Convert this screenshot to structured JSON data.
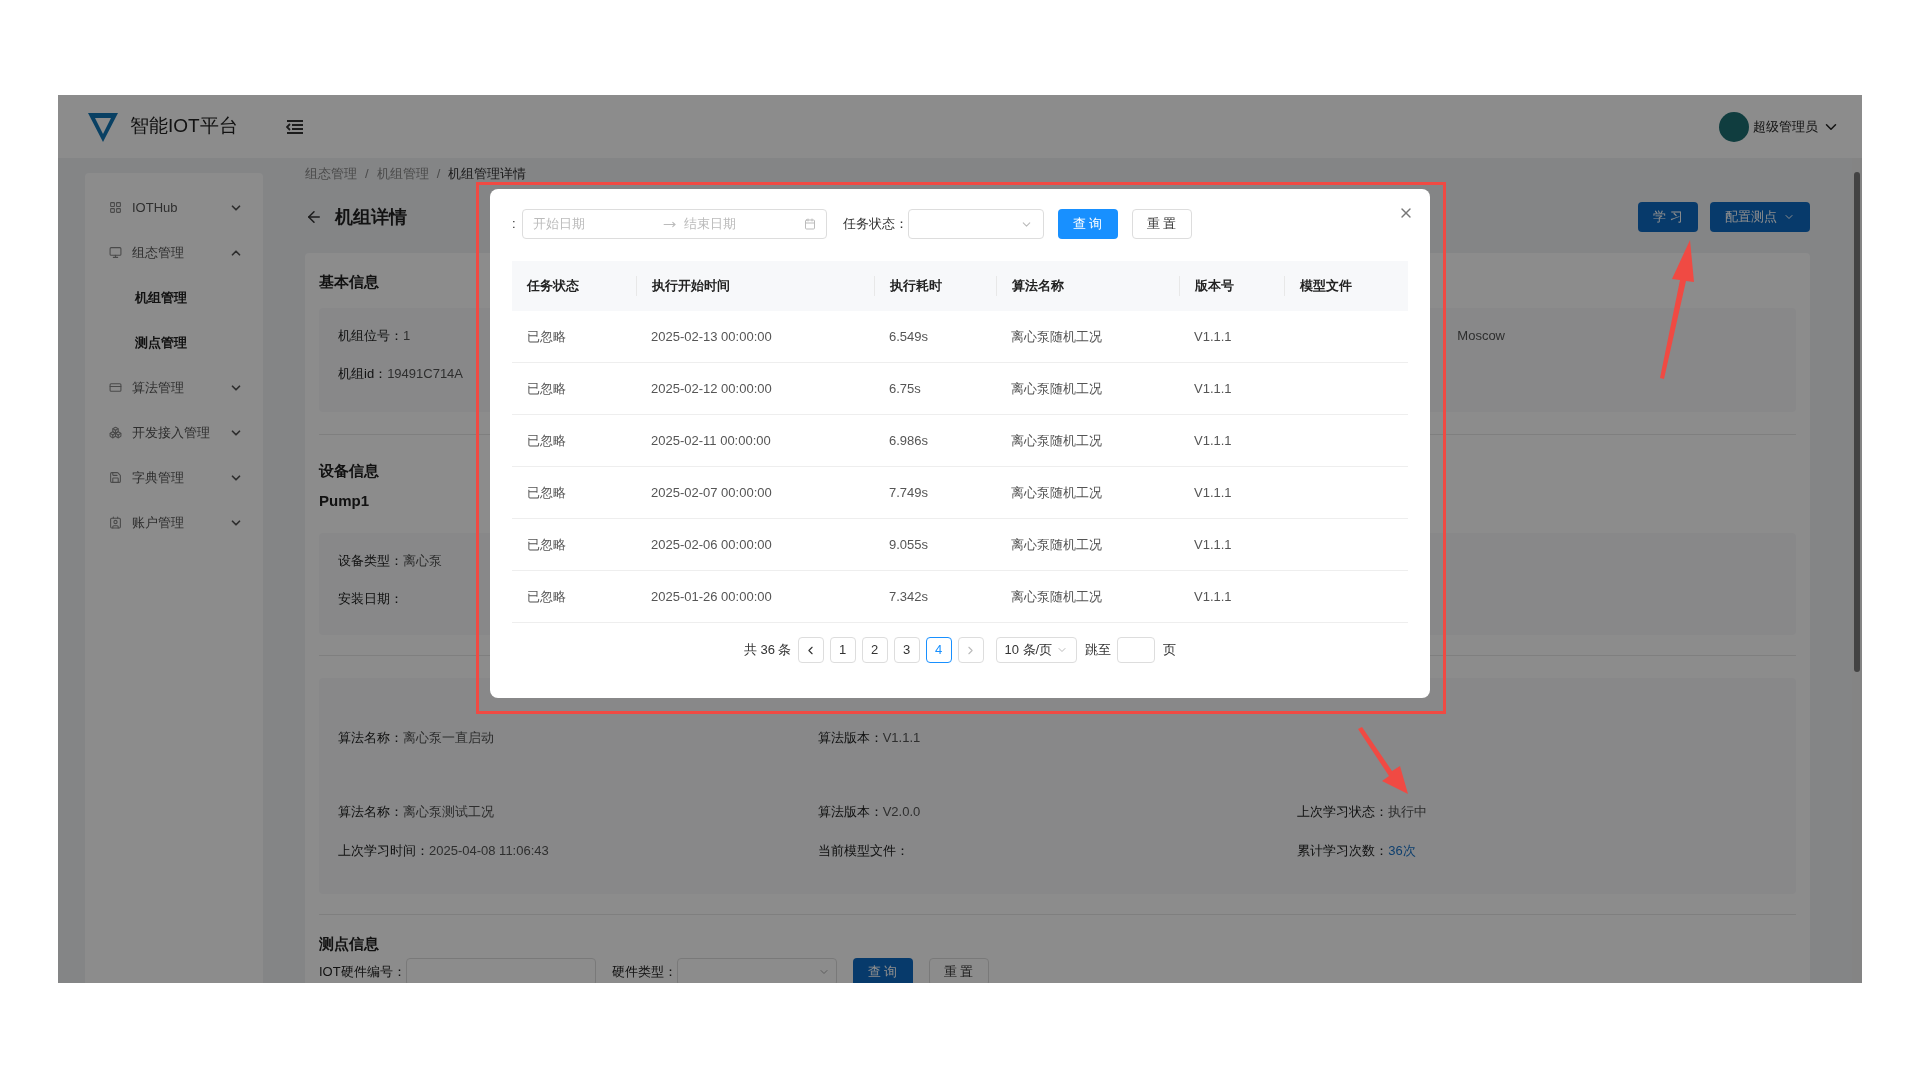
{
  "header": {
    "logo_text": "智能IOT平台",
    "user": "超级管理员"
  },
  "sidebar": {
    "items": [
      {
        "label": "IOTHub",
        "expanded": false
      },
      {
        "label": "组态管理",
        "expanded": true,
        "children": [
          {
            "label": "机组管理"
          },
          {
            "label": "测点管理"
          }
        ]
      },
      {
        "label": "算法管理",
        "expanded": false
      },
      {
        "label": "开发接入管理",
        "expanded": false
      },
      {
        "label": "字典管理",
        "expanded": false
      },
      {
        "label": "账户管理",
        "expanded": false
      }
    ]
  },
  "breadcrumb": [
    {
      "label": "组态管理",
      "separator": "/"
    },
    {
      "label": "机组管理",
      "separator": "/"
    },
    {
      "label": "机组管理详情"
    }
  ],
  "page_title": "机组详情",
  "actions": [
    {
      "label": "学 习",
      "kind": "button"
    },
    {
      "label": "配置测点",
      "kind": "dropdown"
    }
  ],
  "basic_info": {
    "title": "基本信息",
    "fields": [
      {
        "label": "机组位号：",
        "value": "1"
      },
      {
        "label": "机组id：",
        "value": "19491C714A"
      }
    ],
    "extra": "Moscow"
  },
  "device_info": {
    "title": "设备信息",
    "name": "Pump1",
    "fields": [
      {
        "label": "设备类型：",
        "value": "离心泵"
      },
      {
        "label": "安装日期："
      }
    ]
  },
  "algorithms": [
    {
      "fields": [
        {
          "label": "算法名称：",
          "value": "离心泵一直启动"
        },
        {
          "label": "算法版本：",
          "value": "V1.1.1"
        }
      ]
    },
    {
      "fields": [
        {
          "label": "算法名称：",
          "value": "离心泵测试工况"
        },
        {
          "label": "算法版本：",
          "value": "V2.0.0"
        },
        {
          "label": "上次学习状态：",
          "value": "执行中"
        },
        {
          "label": "上次学习时间：",
          "value": "2025-04-08 11:06:43"
        },
        {
          "label": "当前模型文件："
        },
        {
          "label": "累计学习次数：",
          "value": "36次",
          "kind": "link"
        }
      ]
    }
  ],
  "points": {
    "title": "测点信息",
    "filters": [
      {
        "label": "IOT硬件编号：",
        "kind": "input"
      },
      {
        "label": "硬件类型：",
        "kind": "select"
      }
    ],
    "buttons": [
      "查 询",
      "重 置"
    ]
  },
  "modal": {
    "prefix": ":",
    "start_placeholder": "开始日期",
    "end_placeholder": "结束日期",
    "status_label": "任务状态：",
    "buttons": [
      "查 询",
      "重 置"
    ],
    "columns": [
      "任务状态",
      "执行开始时间",
      "执行耗时",
      "算法名称",
      "版本号",
      "模型文件"
    ],
    "rows": [
      [
        "已忽略",
        "2025-02-13 00:00:00",
        "6.549s",
        "离心泵随机工况",
        "V1.1.1"
      ],
      [
        "已忽略",
        "2025-02-12 00:00:00",
        "6.75s",
        "离心泵随机工况",
        "V1.1.1"
      ],
      [
        "已忽略",
        "2025-02-11 00:00:00",
        "6.986s",
        "离心泵随机工况",
        "V1.1.1"
      ],
      [
        "已忽略",
        "2025-02-07 00:00:00",
        "7.749s",
        "离心泵随机工况",
        "V1.1.1"
      ],
      [
        "已忽略",
        "2025-02-06 00:00:00",
        "9.055s",
        "离心泵随机工况",
        "V1.1.1"
      ],
      [
        "已忽略",
        "2025-01-26 00:00:00",
        "7.342s",
        "离心泵随机工况",
        "V1.1.1"
      ]
    ],
    "pagination": {
      "total": "共 36 条",
      "pages": [
        {
          "label": "1",
          "selected": false
        },
        {
          "label": "2",
          "selected": false
        },
        {
          "label": "3",
          "selected": false
        },
        {
          "label": "4",
          "selected": true
        }
      ],
      "page_size": "10 条/页",
      "jump_label": "跳至",
      "page_suffix": "页"
    }
  }
}
